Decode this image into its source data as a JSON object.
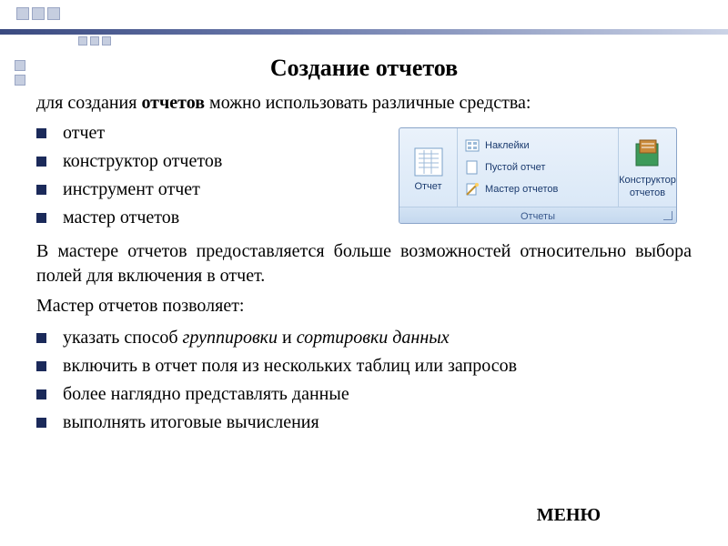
{
  "title": "Создание отчетов",
  "intro_prefix": "для создания ",
  "intro_bold": "отчетов",
  "intro_suffix": " можно использовать различные средства:",
  "tools": [
    "отчет",
    "конструктор отчетов",
    "инструмент отчет",
    "мастер отчетов"
  ],
  "para1": "В мастере отчетов предоставляется больше возможностей относительно выбора полей для включения в отчет.",
  "allows_label": "Мастер отчетов позволяет:",
  "capabilities": [
    {
      "prefix": " указать способ ",
      "it1": "группировки",
      "mid": " и ",
      "it2": "сортировки данных"
    },
    {
      "text": " включить в отчет поля из нескольких таблиц или запросов"
    },
    {
      "text": " более наглядно представлять данные"
    },
    {
      "text": "  выполнять итоговые вычисления"
    }
  ],
  "menu_label": "МЕНЮ",
  "ribbon": {
    "group_title": "Отчеты",
    "btn_report": "Отчет",
    "btn_constructor_line1": "Конструктор",
    "btn_constructor_line2": "отчетов",
    "item_labels": "Наклейки",
    "item_blank": "Пустой отчет",
    "item_wizard": "Мастер отчетов"
  }
}
